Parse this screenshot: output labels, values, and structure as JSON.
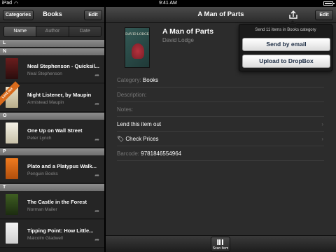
{
  "status_bar": {
    "carrier": "iPad",
    "time": "9:41 AM"
  },
  "left_nav": {
    "categories_label": "Categories",
    "title": "Books",
    "edit_label": "Edit"
  },
  "sort_tabs": [
    "Name",
    "Author",
    "Date"
  ],
  "sections": [
    {
      "letter": "L"
    },
    {
      "letter": "N"
    },
    {
      "letter": "O"
    },
    {
      "letter": "P"
    },
    {
      "letter": "T"
    }
  ],
  "books": [
    {
      "title": "Neal Stephenson - Quicksil...",
      "author": "Neal Stephenson"
    },
    {
      "title": "Night Listener, by Maupin",
      "author": "Armistead Maupin",
      "ribbon": "Lent out"
    },
    {
      "title": "One Up on Wall Street",
      "author": "Peter Lynch"
    },
    {
      "title": "Plato and a Platypus Walk...",
      "author": "Penguin Books"
    },
    {
      "title": "The Castle in the Forest",
      "author": "Norman Mailer"
    },
    {
      "title": "Tipping Point: How Little...",
      "author": "Malcolm Gladwell"
    }
  ],
  "detail": {
    "nav_title": "A Man of Parts",
    "edit_label": "Edit",
    "title": "A Man of Parts",
    "author": "David Lodge",
    "cover_text": "DAVID LODGE",
    "category_label": "Category:",
    "category_value": "Books",
    "description_label": "Description:",
    "notes_label": "Notes:",
    "lend_label": "Lend this item out",
    "check_prices_label": "Check Prices",
    "barcode_label": "Barcode:",
    "barcode_value": "9781846554964"
  },
  "popover": {
    "message": "Send 11 items in Books category",
    "email_label": "Send by email",
    "dropbox_label": "Upload to DropBox"
  },
  "toolbar": {
    "scan_label": "Scan Item"
  }
}
